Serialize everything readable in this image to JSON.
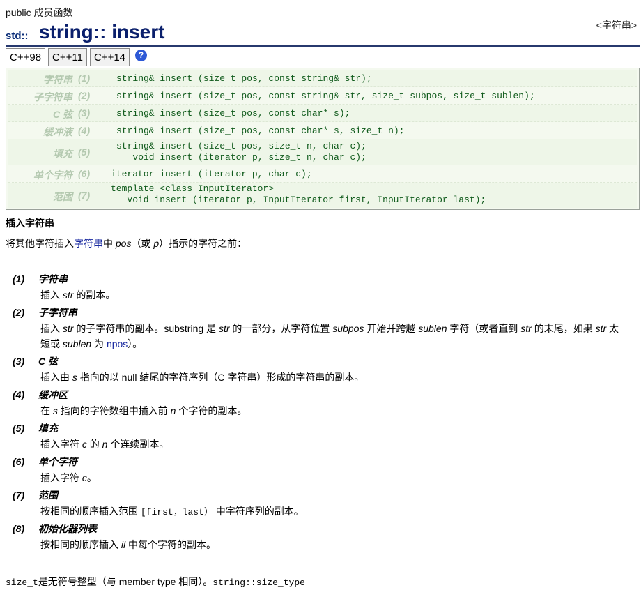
{
  "header": {
    "public_label": "public 成员函数",
    "namespace": "std::",
    "title": "string:: insert",
    "tag": "<字符串>"
  },
  "tabs": [
    {
      "label": "C++98",
      "active": true
    },
    {
      "label": "C++11",
      "active": false
    },
    {
      "label": "C++14",
      "active": false
    }
  ],
  "help_icon": "?",
  "prototypes": [
    {
      "label": "字符串",
      "num": "(1)",
      "code": "string& insert (size_t pos, const string& str);"
    },
    {
      "label": "子字符串",
      "num": "(2)",
      "code": "string& insert (size_t pos, const string& str, size_t subpos, size_t sublen);"
    },
    {
      "label": "C 弦",
      "num": "(3)",
      "code": "string& insert (size_t pos, const char* s);"
    },
    {
      "label": "缓冲液",
      "num": "(4)",
      "code": "string& insert (size_t pos, const char* s, size_t n);"
    },
    {
      "label": "填充",
      "num": "(5)",
      "code": "string& insert (size_t pos, size_t n, char c);\n   void insert (iterator p, size_t n, char c);"
    },
    {
      "label": "单个字符",
      "num": "(6)",
      "code": "iterator insert (iterator p, char c);"
    },
    {
      "label": "范围",
      "num": "(7)",
      "code": "template <class InputIterator>\n   void insert (iterator p, InputIterator first, InputIterator last);"
    }
  ],
  "section": {
    "title": "插入字符串",
    "desc_before": "将其他字符插入",
    "desc_link": "字符串",
    "desc_mid": "中 ",
    "desc_pos": "pos",
    "desc_or": "（或 ",
    "desc_p": "p",
    "desc_after": "）指示的字符之前："
  },
  "descriptions": [
    {
      "num": "(1)",
      "title": "字符串",
      "text": [
        "插入 ",
        {
          "i": "str"
        },
        " 的副本。"
      ]
    },
    {
      "num": "(2)",
      "title": "子字符串",
      "text": [
        "插入 ",
        {
          "i": "str"
        },
        " 的子字符串的副本。substring 是 ",
        {
          "i": "str"
        },
        " 的一部分，从字符位置 ",
        {
          "i": "subpos"
        },
        " 开始并跨越 ",
        {
          "i": "sublen"
        },
        " 字符（或者直到 ",
        {
          "i": "str"
        },
        " 的末尾，如果 ",
        {
          "i": "str"
        },
        " 太短或 ",
        {
          "i": "sublen"
        },
        " 为 ",
        {
          "link": "npos"
        },
        "）。"
      ]
    },
    {
      "num": "(3)",
      "title": "C 弦",
      "text": [
        "插入由 ",
        {
          "i": "s"
        },
        " 指向的以 null 结尾的字符序列（C 字符串）形成的字符串的副本。"
      ]
    },
    {
      "num": "(4)",
      "title": "缓冲区",
      "text": [
        "在 ",
        {
          "i": "s"
        },
        " 指向的字符数组中插入前 ",
        {
          "i": "n"
        },
        " 个字符的副本。"
      ]
    },
    {
      "num": "(5)",
      "title": "填充",
      "text": [
        "插入字符 ",
        {
          "i": "c"
        },
        " 的 ",
        {
          "i": "n"
        },
        " 个连续副本。"
      ]
    },
    {
      "num": "(6)",
      "title": "单个字符",
      "text": [
        "插入字符 ",
        {
          "i": "c"
        },
        "。"
      ]
    },
    {
      "num": "(7)",
      "title": "范围",
      "text": [
        "按相同的顺序插入范围 ",
        {
          "m": "[first，last）"
        },
        " 中字符序列的副本。"
      ]
    },
    {
      "num": "(8)",
      "title": "初始化器列表",
      "text": [
        "按相同的顺序插入 ",
        {
          "i": "il"
        },
        " 中每个字符的副本。"
      ]
    }
  ],
  "footer": {
    "code1": "size_t",
    "text": "是无符号整型（与 member type 相同）。",
    "code2": "string::size_type"
  }
}
